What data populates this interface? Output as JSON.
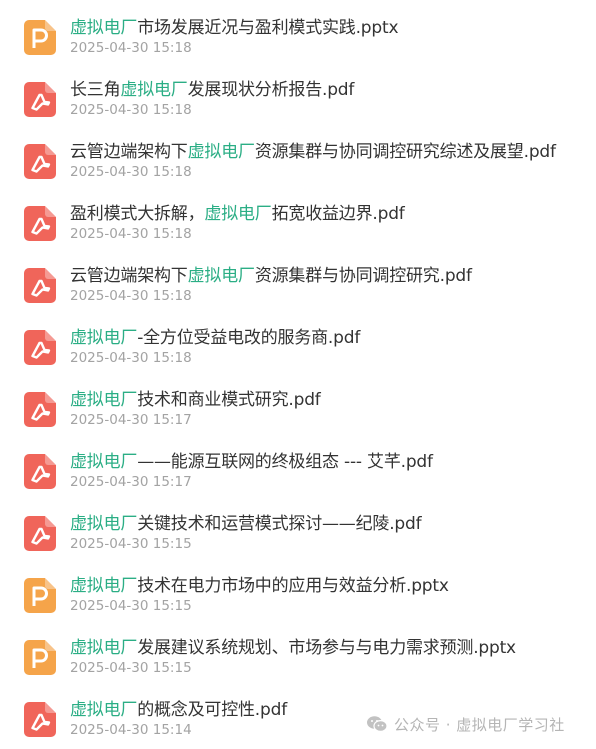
{
  "files": [
    {
      "type": "pptx",
      "icon": "ppt-file-icon",
      "prefix": "",
      "highlight": "虚拟电厂",
      "suffix": "市场发展近况与盈利模式实践.pptx",
      "date": "2025-04-30 15:18"
    },
    {
      "type": "pdf",
      "icon": "pdf-file-icon",
      "prefix": "长三角",
      "highlight": "虚拟电厂",
      "suffix": "发展现状分析报告.pdf",
      "date": "2025-04-30 15:18"
    },
    {
      "type": "pdf",
      "icon": "pdf-file-icon",
      "prefix": "云管边端架构下",
      "highlight": "虚拟电厂",
      "suffix": "资源集群与协同调控研究综述及展望.pdf",
      "date": "2025-04-30 15:18"
    },
    {
      "type": "pdf",
      "icon": "pdf-file-icon",
      "prefix": "盈利模式大拆解，",
      "highlight": "虚拟电厂",
      "suffix": "拓宽收益边界.pdf",
      "date": "2025-04-30 15:18"
    },
    {
      "type": "pdf",
      "icon": "pdf-file-icon",
      "prefix": "云管边端架构下",
      "highlight": "虚拟电厂",
      "suffix": "资源集群与协同调控研究.pdf",
      "date": "2025-04-30 15:18"
    },
    {
      "type": "pdf",
      "icon": "pdf-file-icon",
      "prefix": "",
      "highlight": "虚拟电厂",
      "suffix": "-全方位受益电改的服务商.pdf",
      "date": "2025-04-30 15:18"
    },
    {
      "type": "pdf",
      "icon": "pdf-file-icon",
      "prefix": "",
      "highlight": "虚拟电厂",
      "suffix": "技术和商业模式研究.pdf",
      "date": "2025-04-30 15:17"
    },
    {
      "type": "pdf",
      "icon": "pdf-file-icon",
      "prefix": "",
      "highlight": "虚拟电厂",
      "suffix": "——能源互联网的终极组态 --- 艾芊.pdf",
      "date": "2025-04-30 15:17"
    },
    {
      "type": "pdf",
      "icon": "pdf-file-icon",
      "prefix": "",
      "highlight": "虚拟电厂",
      "suffix": "关键技术和运营模式探讨——纪陵.pdf",
      "date": "2025-04-30 15:15"
    },
    {
      "type": "pptx",
      "icon": "ppt-file-icon",
      "prefix": "",
      "highlight": "虚拟电厂",
      "suffix": "技术在电力市场中的应用与效益分析.pptx",
      "date": "2025-04-30 15:15"
    },
    {
      "type": "pptx",
      "icon": "ppt-file-icon",
      "prefix": "",
      "highlight": "虚拟电厂",
      "suffix": "发展建议系统规划、市场参与与电力需求预测.pptx",
      "date": "2025-04-30 15:15"
    },
    {
      "type": "pdf",
      "icon": "pdf-file-icon",
      "prefix": "",
      "highlight": "虚拟电厂",
      "suffix": "的概念及可控性.pdf",
      "date": "2025-04-30 15:14"
    }
  ],
  "watermark": {
    "icon": "wechat-icon",
    "text": "公众号 · 虚拟电厂学习社"
  },
  "colors": {
    "highlight": "#2bae85",
    "pdf_icon": "#f0655a",
    "ppt_icon": "#f5a44a",
    "text": "#333333",
    "date": "#a3a3a3"
  }
}
